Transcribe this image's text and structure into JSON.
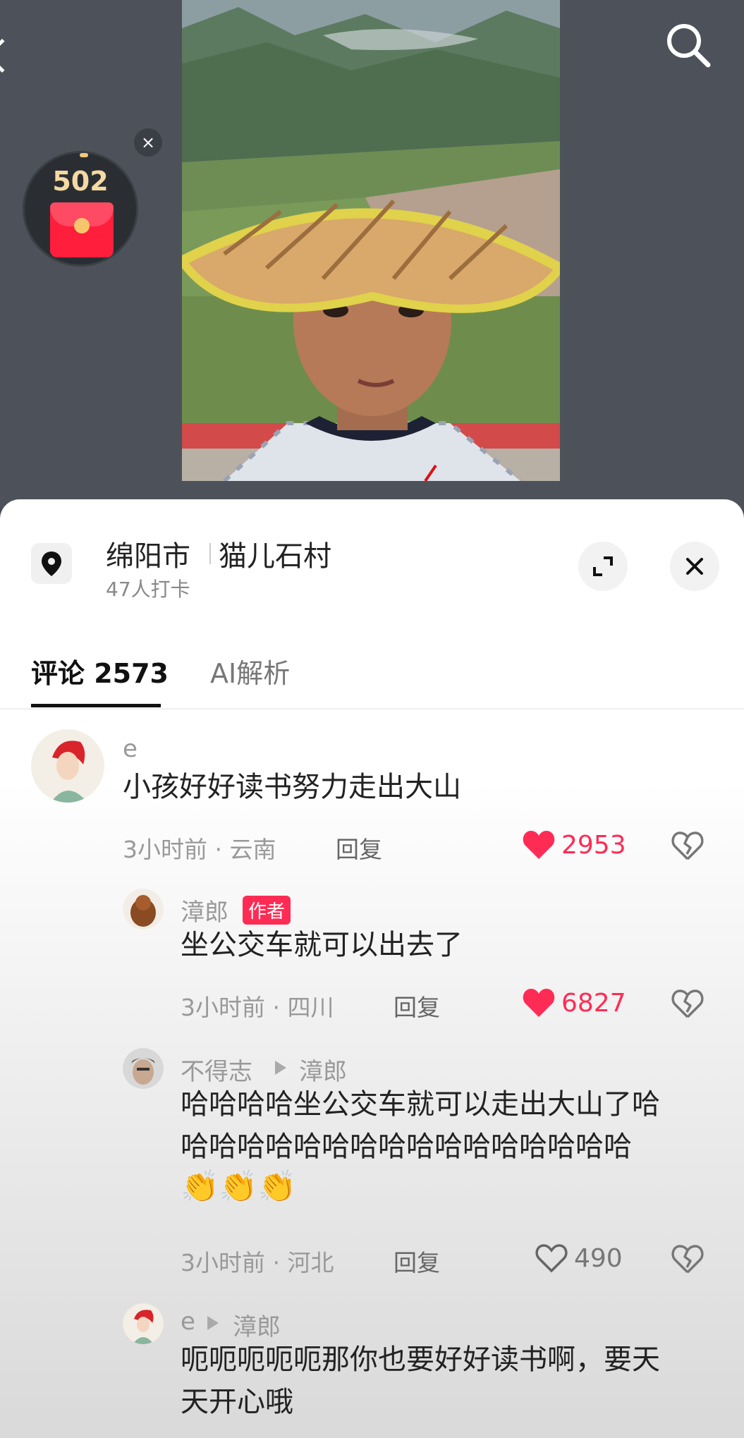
{
  "red_packet": {
    "count": "502"
  },
  "location": {
    "city": "绵阳市",
    "place": "猫儿石村",
    "checkins": "47人打卡"
  },
  "tabs": {
    "comments": "评论 2573",
    "ai": "AI解析"
  },
  "comments": [
    {
      "user": "e",
      "text": "小孩好好读书努力走出大山",
      "time": "3小时前 · 云南",
      "reply": "回复",
      "likes": "2953",
      "liked": true
    },
    {
      "user": "漳郎",
      "badge": "作者",
      "text": "坐公交车就可以出去了",
      "time": "3小时前 · 四川",
      "reply": "回复",
      "likes": "6827",
      "liked": true
    },
    {
      "user": "不得志",
      "reply_to": "漳郎",
      "text_line1": "哈哈哈哈坐公交车就可以走出大山了哈",
      "text_line2": "哈哈哈哈哈哈哈哈哈哈哈哈哈哈哈哈",
      "emoji": "👏👏👏",
      "time": "3小时前 · 河北",
      "reply": "回复",
      "likes": "490",
      "liked": false
    },
    {
      "user": "e",
      "reply_to": "漳郎",
      "text_line1": "呃呃呃呃呃那你也要好好读书啊，要天",
      "text_line2": "天开心哦"
    }
  ],
  "colors": {
    "accent": "#fe2c55",
    "video_bg": "#4d525a"
  }
}
